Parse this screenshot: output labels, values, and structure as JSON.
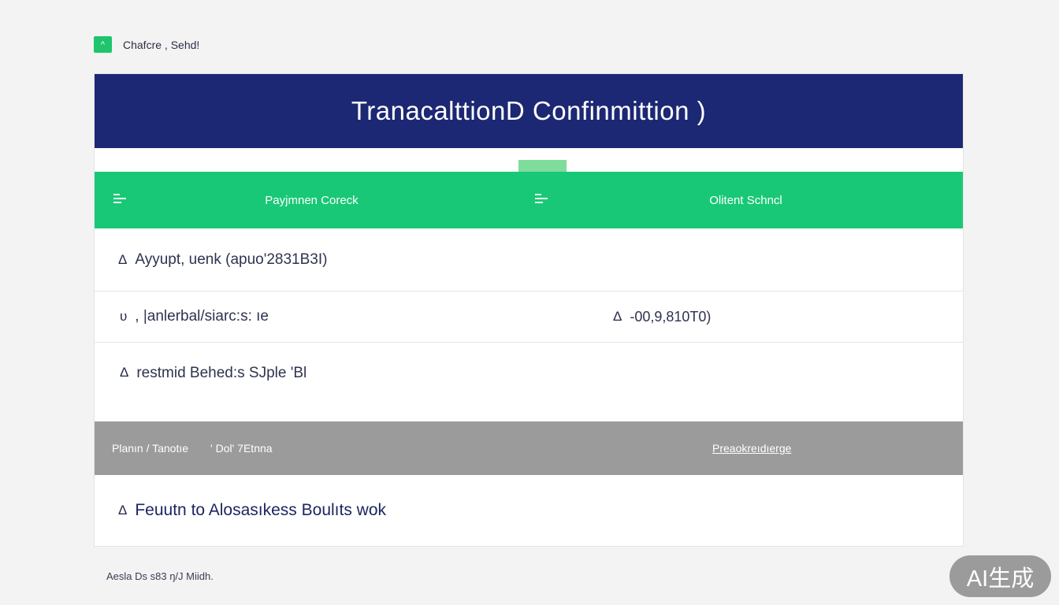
{
  "top_badge": {
    "icon": "chevron-up-icon",
    "icon_glyph": "^",
    "label": "Chafcre , Sehd!"
  },
  "header": {
    "title": "TranacalttionD Confinmittion )"
  },
  "green_bar": {
    "left_label": "Payjmnen Coreck",
    "right_label": "Olitent Schncl",
    "menu_icon": "menu-icon"
  },
  "rows": [
    {
      "icon": "triangle-icon",
      "glyph": "Δ",
      "text": "Ayyupt, uenk (apuo'2831Β3Ι)"
    },
    {
      "icon": "triangle-icon",
      "glyph": "υ",
      "text": ", |anlerbal/siarc:s: ıe",
      "right_glyph": "Δ",
      "right_value": "-00,9,810Τ0)"
    },
    {
      "icon": "triangle-icon",
      "glyph": "Δ",
      "text": "restmid Behed:s SJple 'Bl"
    }
  ],
  "gray_bar": {
    "left_a": "Planın / Tanotıe",
    "left_b": "' Dol' 7Etnna",
    "right": "Preaokreıdıerge"
  },
  "footer_row": {
    "glyph": "Δ",
    "text": "Feuutn to Alosasıkess Boulıts wok"
  },
  "bottom_note": "Aesla Ds s83 ŋ/J Miidh.",
  "watermark": "AI生成",
  "colors": {
    "header_bg": "#1c2873",
    "green": "#19c876",
    "gray_bar": "#9b9b9b",
    "page_bg": "#f3f3f3"
  }
}
